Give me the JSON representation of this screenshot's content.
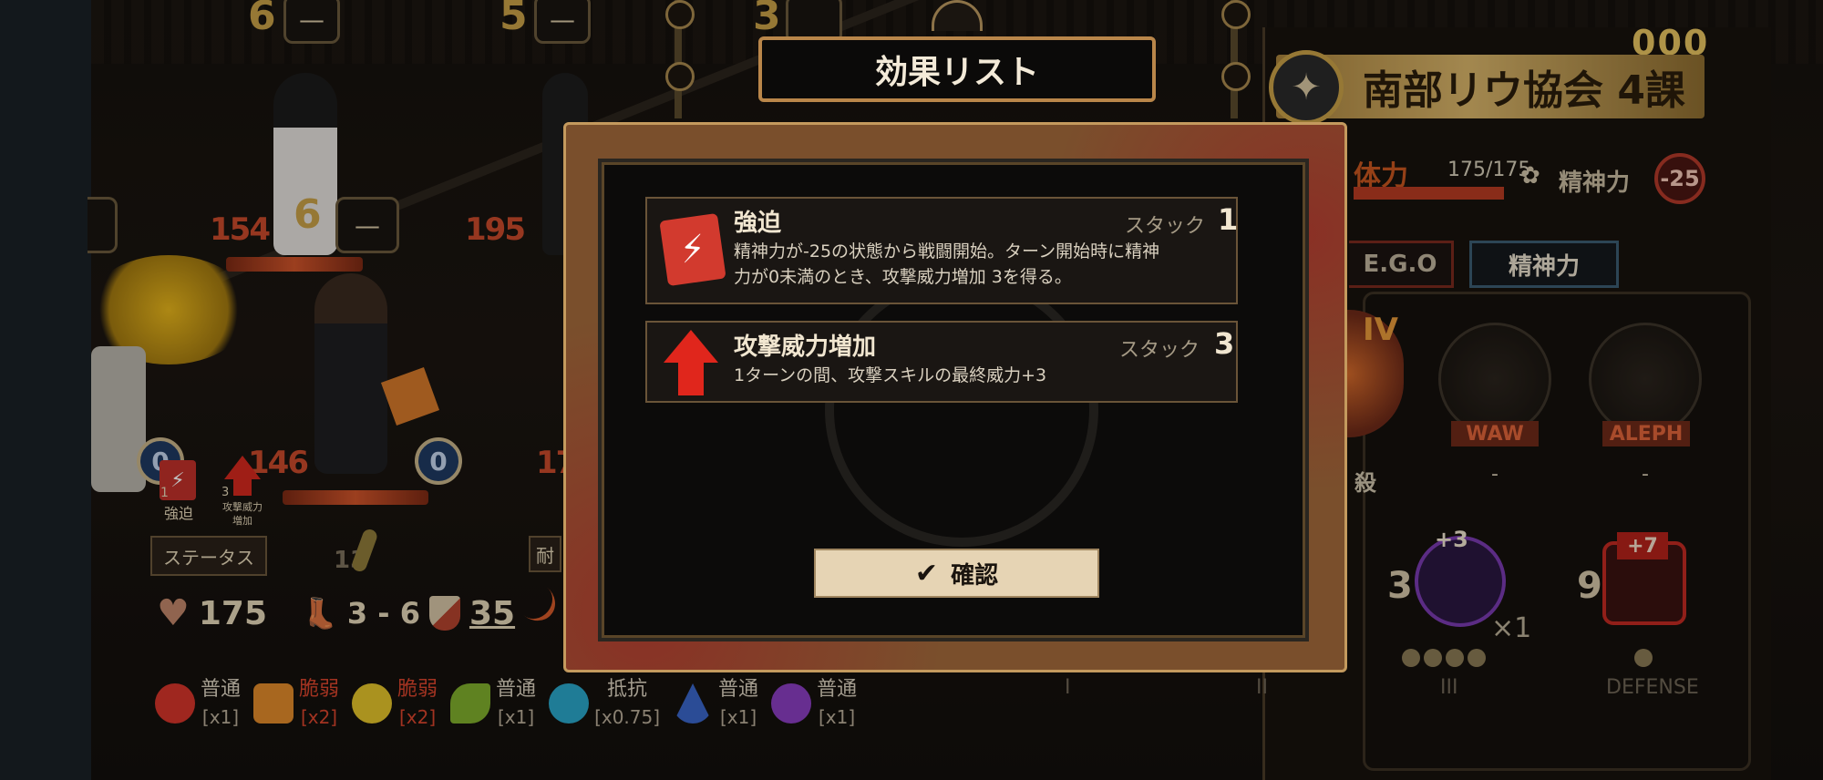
{
  "lanes": {
    "top_numbers": [
      "6",
      "5",
      "3"
    ],
    "hex_dash": "—"
  },
  "characters": [
    {
      "hp": "154",
      "speed": "6",
      "speed_slot": "—"
    },
    {
      "hp": "195"
    },
    {
      "hp": "146",
      "speed_slot": "0"
    },
    {
      "hp": "17"
    }
  ],
  "left_slot_value": "0",
  "buff_icons": [
    {
      "count": "1",
      "label": "強迫"
    },
    {
      "count": "3",
      "label": "攻撃威力\n増加"
    }
  ],
  "left_panel": {
    "status_button": "ステータス",
    "side_tab": "耐",
    "speed_value": "13",
    "hp": "175",
    "speed_range": "3 - 6",
    "defense": "35",
    "resistances": [
      {
        "icon": "wrath-icon",
        "label": "普通",
        "mult": "[x1]",
        "label_color": "#d8cfbd",
        "color": "#d4342a"
      },
      {
        "icon": "lust-icon",
        "label": "脆弱",
        "mult": "[x2]",
        "label_color": "#d9452c",
        "color": "#e08a2a"
      },
      {
        "icon": "sloth-icon",
        "label": "脆弱",
        "mult": "[x2]",
        "label_color": "#d9452c",
        "color": "#e3c32a"
      },
      {
        "icon": "gluttony-icon",
        "label": "普通",
        "mult": "[x1]",
        "label_color": "#d8cfbd",
        "color": "#7fae2c"
      },
      {
        "icon": "gloom-icon",
        "label": "抵抗",
        "mult": "[x0.75]",
        "label_color": "#d8cfbd",
        "color": "#2aa6c8"
      },
      {
        "icon": "pride-icon",
        "label": "普通",
        "mult": "[x1]",
        "label_color": "#d8cfbd",
        "color": "#3a66c8"
      },
      {
        "icon": "envy-icon",
        "label": "普通",
        "mult": "[x1]",
        "label_color": "#d8cfbd",
        "color": "#8a3ec0"
      }
    ]
  },
  "right_panel": {
    "id_digits": "000",
    "org_name": "南部リウ協会 4課",
    "hp_label": "体力",
    "hp_value": "175/175",
    "sp_label": "精神力",
    "sp_value": "-25",
    "tabs": [
      "E.G.O",
      "精神力"
    ],
    "ego_grade_roman": "IV",
    "ego_labels": [
      "WAW",
      "ALEPH"
    ],
    "ego_values": [
      "殺",
      "-",
      "-"
    ],
    "skills": [
      {
        "cost": "3",
        "bonus": "+3",
        "count": "×1"
      },
      {
        "cost": "9",
        "bonus": "+7"
      }
    ],
    "skill_row_labels": [
      "I",
      "II",
      "III",
      "DEFENSE"
    ]
  },
  "modal": {
    "title": "効果リスト",
    "effects": [
      {
        "name": "強迫",
        "stack_label": "スタック",
        "stack": "1",
        "description_line1": "精神力が-25の状態から戦闘開始。ターン開始時に精神",
        "description_line2": "力が0未満のとき、攻撃威力増加 3を得る。"
      },
      {
        "name": "攻撃威力増加",
        "stack_label": "スタック",
        "stack": "3",
        "description_line1": "1ターンの間、攻撃スキルの最終威力+3"
      }
    ],
    "confirm_label": "確認"
  }
}
